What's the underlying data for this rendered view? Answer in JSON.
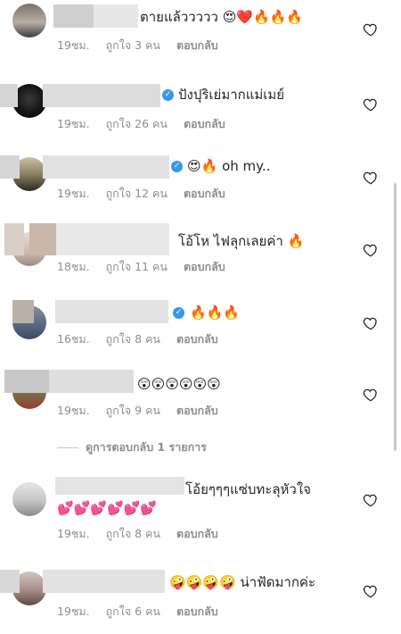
{
  "comments": [
    {
      "text": "ตายแล้ววววว 😍❤️🔥🔥🔥",
      "time": "19ชม.",
      "likes": "ถูกใจ 3 คน",
      "reply": "ตอบกลับ",
      "verified": false
    },
    {
      "text": "ปังปุริเย่มากแม่เมย์",
      "time": "19ชม.",
      "likes": "ถูกใจ 26 คน",
      "reply": "ตอบกลับ",
      "verified": true
    },
    {
      "text": "😍🔥 oh my..",
      "time": "19ชม.",
      "likes": "ถูกใจ 12 คน",
      "reply": "ตอบกลับ",
      "verified": true
    },
    {
      "text": "โอ้โห ไฟลุกเลยค่า 🔥",
      "time": "18ชม.",
      "likes": "ถูกใจ 11 คน",
      "reply": "ตอบกลับ",
      "verified": false
    },
    {
      "text": "🔥🔥🔥",
      "time": "16ชม.",
      "likes": "ถูกใจ 8 คน",
      "reply": "ตอบกลับ",
      "verified": true
    },
    {
      "text": "😲😲😲😲😲😲",
      "time": "19ชม.",
      "likes": "ถูกใจ 9 คน",
      "reply": "ตอบกลับ",
      "verified": false
    },
    {
      "text": "โอ้ยๆๆๆแซ่บทะลุหัวใจ",
      "text2": "💕💕💕💕💕💕",
      "time": "19ชม.",
      "likes": "ถูกใจ 8 คน",
      "reply": "ตอบกลับ",
      "verified": false
    },
    {
      "text": "🤪🤪🤪🤪 น่าฟัดมากค่ะ",
      "time": "19ชม.",
      "likes": "ถูกใจ 6 คน",
      "reply": "ตอบกลับ",
      "verified": false
    }
  ],
  "view_replies": "ดูการตอบกลับ 1 รายการ",
  "icons": {
    "like": "heart-outline-icon",
    "verified": "verified-badge-icon"
  },
  "colors": {
    "text": "#262626",
    "meta": "#8e8e8e",
    "verified": "#3897f0"
  }
}
